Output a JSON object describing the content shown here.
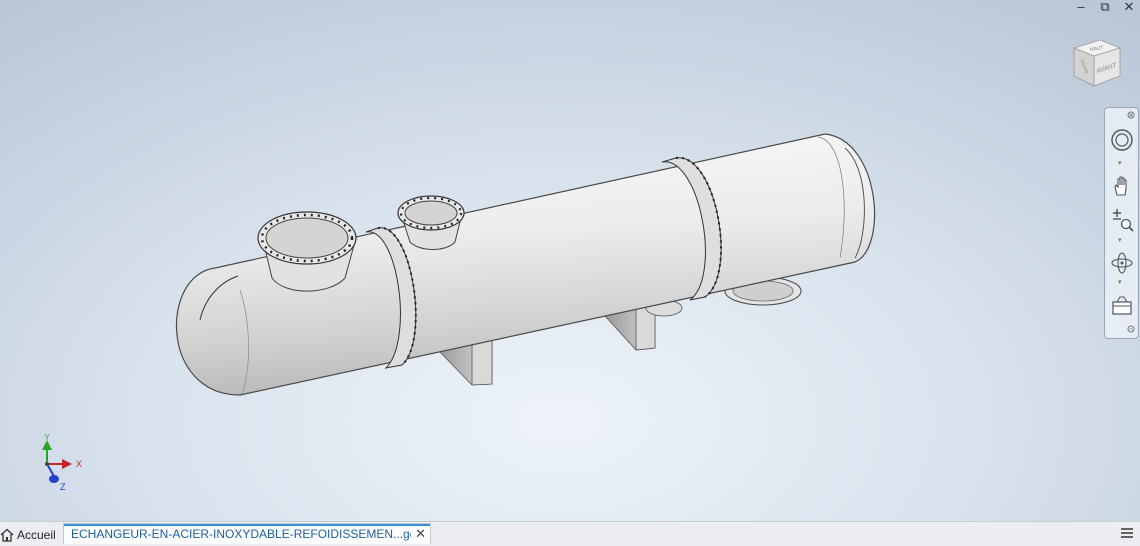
{
  "window": {
    "minimize_icon": "minimize-icon",
    "restore_icon": "restore-icon",
    "close_icon": "close-icon",
    "minimize_glyph": "–",
    "restore_glyph": "⧉",
    "close_glyph": "✕"
  },
  "viewcube": {
    "top_label": "HAUT",
    "front_label": "AVANT",
    "side_label": "DROITE"
  },
  "navigation_bar": {
    "items": [
      {
        "name": "steering-wheel-icon"
      },
      {
        "name": "pan-icon"
      },
      {
        "name": "zoom-icon"
      },
      {
        "name": "orbit-icon"
      },
      {
        "name": "look-at-icon"
      }
    ]
  },
  "coordinate_triad": {
    "x_label": "X",
    "y_label": "Y",
    "z_label": "Z",
    "x_color": "#c0262c",
    "y_color": "#2aa52a",
    "z_color": "#2244cc"
  },
  "tabs": {
    "home_label": "Accueil",
    "document_label": "ECHANGEUR-EN-ACIER-INOXYDABLE-REFOIDISSEMEN...ger.iam",
    "close_glyph": "✕"
  },
  "colors": {
    "accent": "#3c8fd6",
    "model_body": "#e6e6e6"
  }
}
